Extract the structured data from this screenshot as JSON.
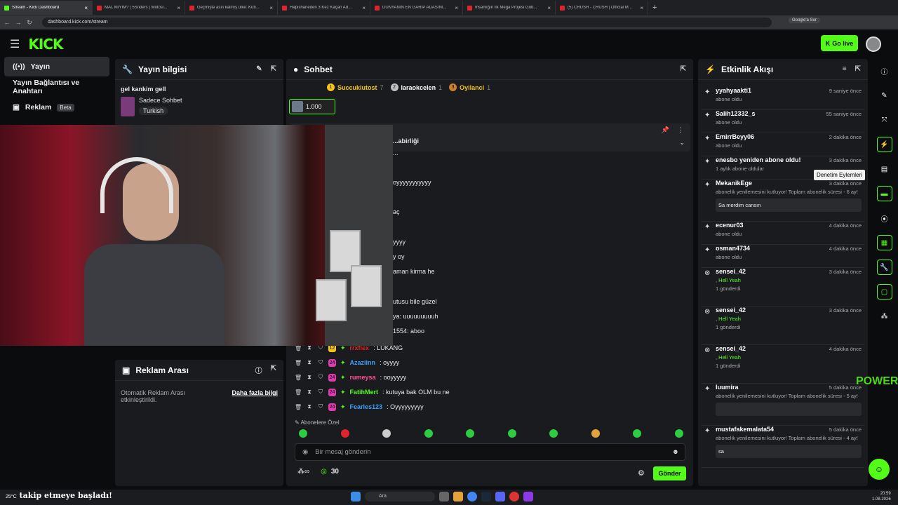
{
  "browser": {
    "tabs": [
      {
        "title": "Stream - Kick Dashboard",
        "active": true
      },
      {
        "title": "MAL MIYIM? | 5Sriders | Motosi..."
      },
      {
        "title": "Geçmişte asılı kalmış ülke: Küb..."
      },
      {
        "title": "Hapishaneden 3 Kez Kaçan Ad..."
      },
      {
        "title": "DÜNYANIN EN GARİP ADASINI..."
      },
      {
        "title": "İnsanlığın İlk Mega Projesi Göb..."
      },
      {
        "title": "(5) CRUSH - CRUSH | Official M..."
      }
    ],
    "url": "dashboard.kick.com/stream",
    "google_sor": "Google'a Sor"
  },
  "topbar": {
    "logo": "KICK",
    "go_live": "Go live"
  },
  "nav": {
    "items": [
      {
        "label": "Yayın",
        "icon": "((•))",
        "selected": true
      },
      {
        "label": "Yayın Bağlantısı ve Anahtarı"
      },
      {
        "label": "Reklam",
        "badge": "Beta"
      }
    ]
  },
  "stream_info": {
    "title": "Yayın bilgisi",
    "stream_title": "gel kankim gell",
    "category": "Sadece Sohbet",
    "language": "Turkish"
  },
  "ad_break": {
    "title": "Reklam Arası",
    "text": "Otomatik Reklam Arası etkinleştirildi.",
    "link": "Daha fazla bilgi"
  },
  "chat": {
    "title": "Sohbet",
    "leaders": [
      {
        "rank": "1",
        "name": "Succukiutost",
        "count": "7"
      },
      {
        "rank": "2",
        "name": "laraokcelen",
        "count": "1"
      },
      {
        "rank": "3",
        "name": "Oyilanci",
        "count": "1"
      }
    ],
    "gift_amount": "1.000",
    "pinned_title": "...abirliği",
    "partial_lines": [
      "...",
      "oyyyyyyyyyyy",
      "aç",
      "yyyy",
      "y oy",
      "aman kirma he",
      "utusu bile güzel",
      "ya: uuuuuuuuuh",
      "1554: aboo"
    ],
    "messages": [
      {
        "user": "rrxfiex",
        "text": ": LUKANG",
        "color": "#e0242b",
        "badge": "12",
        "badge_color": "#f5c518"
      },
      {
        "user": "Azaziinn",
        "text": ": oyyyy",
        "color": "#3aa0ff",
        "badge": "24",
        "badge_color": "#e03ab0"
      },
      {
        "user": "rumeysa",
        "text": ": ooyyyyy",
        "color": "#ff4f9a",
        "badge": "24",
        "badge_color": "#e03ab0"
      },
      {
        "user": "FatihMert",
        "text": ": kutuya bak OLM bu ne",
        "color": "#53fc18",
        "badge": "24",
        "badge_color": "#e03ab0"
      },
      {
        "user": "Fearles123",
        "text": ": Oyyyyyyyyy",
        "color": "#3aa0ff",
        "badge": "24",
        "badge_color": "#e03ab0"
      }
    ],
    "emote_label": "Abonelere Özel",
    "placeholder": "Bir mesaj gönderin",
    "points": "30",
    "send": "Gönder"
  },
  "events": {
    "title": "Etkinlik Akışı",
    "items": [
      {
        "user": "yyahyaakti1",
        "time": "9 saniye önce",
        "sub": "abone oldu",
        "icon": "✦"
      },
      {
        "user": "Salih12332_s",
        "time": "55 saniye önce",
        "sub": "abone oldu",
        "icon": "✦"
      },
      {
        "user": "EmirrBeyy06",
        "time": "2 dakika önce",
        "sub": "abone oldu",
        "icon": "✦"
      },
      {
        "user": "enesbo yeniden abone oldu!",
        "time": "3 dakika önce",
        "sub": "1 aylık abone oldular",
        "icon": "✦"
      },
      {
        "user": "MekanikEge",
        "time": "3 dakika önce",
        "sub": "abonelik yenilemesini kutluyor! Toplam abonelik süresi - 6 ay!",
        "msg": "Sa merdim cansın",
        "icon": "✦"
      },
      {
        "user": "ecenur03",
        "time": "4 dakika önce",
        "sub": "abone oldu",
        "icon": "✦"
      },
      {
        "user": "osman4734",
        "time": "4 dakika önce",
        "sub": "abone oldu",
        "icon": "✦"
      },
      {
        "user": "sensei_42",
        "time": "3 dakika önce",
        "sub": ", Hell Yeah",
        "sub2": "1 gönderdi",
        "icon": "K"
      },
      {
        "user": "sensei_42",
        "time": "3 dakika önce",
        "sub": ", Hell Yeah",
        "sub2": "1 gönderdi",
        "icon": "K"
      },
      {
        "user": "sensei_42",
        "time": "4 dakika önce",
        "sub": ", Hell Yeah",
        "sub2": "1 gönderdi",
        "icon": "K"
      },
      {
        "user": "luumira",
        "time": "5 dakika önce",
        "sub": "abonelik yenilemesini kutluyor! Toplam abonelik süresi - 5 ay!",
        "msg": "",
        "icon": "✦"
      },
      {
        "user": "mustafakemalata54",
        "time": "5 dakika önce",
        "sub": "abonelik yenilemesini kutluyor! Toplam abonelik süresi - 4 ay!",
        "msg": "sa",
        "icon": "✦"
      }
    ],
    "tooltip": "Denetim Eylemleri"
  },
  "overlay": {
    "follow_text": "takip etmeye başladı!",
    "watermark": "POWER"
  },
  "taskbar": {
    "search": "Ara",
    "time": "20:59",
    "date": "1.08.2026",
    "weather": "25°C"
  },
  "colors": {
    "accent": "#53fc18"
  }
}
